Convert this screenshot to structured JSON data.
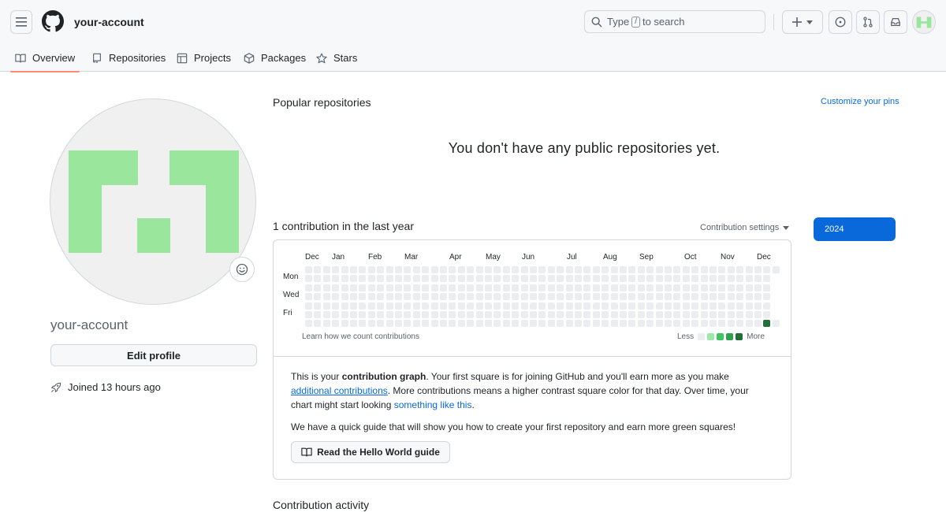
{
  "header": {
    "account_name": "your-account",
    "search_pre": "Type",
    "search_key": "/",
    "search_post": "to search"
  },
  "tabs": [
    {
      "label": "Overview",
      "icon": "book-icon",
      "selected": true
    },
    {
      "label": "Repositories",
      "icon": "repo-icon"
    },
    {
      "label": "Projects",
      "icon": "table-icon"
    },
    {
      "label": "Packages",
      "icon": "package-icon"
    },
    {
      "label": "Stars",
      "icon": "star-icon"
    }
  ],
  "profile": {
    "name": "your-account",
    "edit_label": "Edit profile",
    "joined": "Joined 13 hours ago"
  },
  "popular": {
    "title": "Popular repositories",
    "customize": "Customize your pins",
    "empty": "You don't have any public repositories yet."
  },
  "contributions": {
    "title": "1 contribution in the last year",
    "settings": "Contribution settings",
    "year": "2024",
    "months": [
      "Dec",
      "Jan",
      "Feb",
      "Mar",
      "Apr",
      "May",
      "Jun",
      "Jul",
      "Aug",
      "Sep",
      "Oct",
      "Nov",
      "Dec"
    ],
    "days": [
      "Mon",
      "Wed",
      "Fri"
    ],
    "learn": "Learn how we count contributions",
    "legend_less": "Less",
    "legend_more": "More",
    "colors": {
      "empty": "#ebedf0",
      "l1": "#9be9a8",
      "l2": "#40c463",
      "l3": "#30a14e",
      "l4": "#216e39"
    }
  },
  "info": {
    "p1_a": "This is your ",
    "p1_b": "contribution graph",
    "p1_c": ". Your first square is for joining GitHub and you'll earn more as you make ",
    "p1_link1": "additional contributions",
    "p1_d": ". More contributions means a higher contrast square color for that day. Over time, your chart might start looking ",
    "p1_link2": "something like this",
    "p1_e": ".",
    "p2": "We have a quick guide that will show you how to create your first repository and earn more green squares!",
    "guide_label": "Read the Hello World guide"
  },
  "activity": {
    "title": "Contribution activity"
  }
}
